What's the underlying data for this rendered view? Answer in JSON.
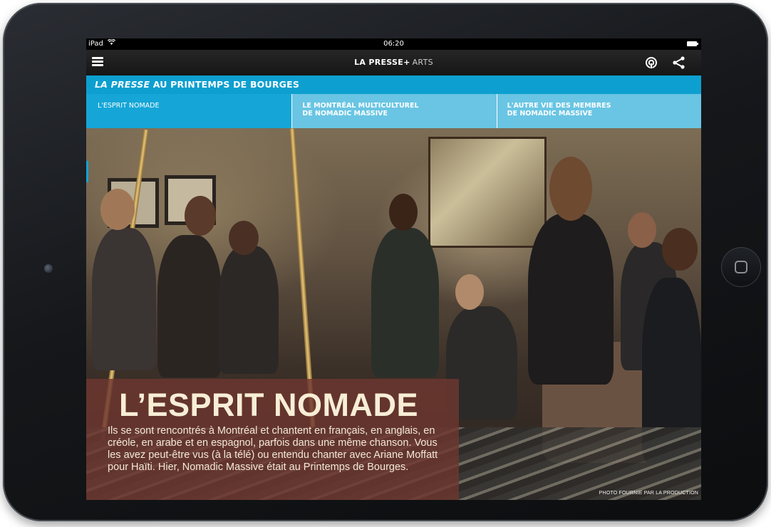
{
  "status_bar": {
    "device": "iPad",
    "time": "06:20"
  },
  "nav": {
    "title_brand": "LA PRESSE",
    "title_plus": "+",
    "title_section": "ARTS",
    "menu_icon": "hamburger-menu-icon",
    "audio_icon": "audio-icon",
    "share_icon": "share-icon"
  },
  "banner": {
    "italic_part": "LA PRESSE",
    "rest": " AU PRINTEMPS DE BOURGES"
  },
  "tabs": [
    {
      "label": "L'ESPRIT NOMADE",
      "active": true
    },
    {
      "label": "LE MONTRÉAL MULTICULTUREL\nDE NOMADIC MASSIVE",
      "active": false
    },
    {
      "label": "L'AUTRE VIE DES MEMBRES\nDE NOMADIC MASSIVE",
      "active": false
    }
  ],
  "article": {
    "headline": "L’ESPRIT NOMADE",
    "lede": "Ils se sont rencontrés à Montréal et chantent en français, en anglais, en créole, en arabe et en espagnol, parfois dans une même chanson. Vous les avez peut-être vus (à la télé) ou entendu chanter avec Ariane Moffatt pour Haïti. Hier, Nomadic Massive était au Printemps de Bourges.",
    "photo_credit": "PHOTO FOURNIE PAR LA PRODUCTION"
  },
  "colors": {
    "banner": "#0d9fd0",
    "tab_active": "#15a6d7",
    "tab_inactive": "#69c5e3",
    "article_overlay": "#6e3730",
    "headline": "#f8eed6"
  }
}
